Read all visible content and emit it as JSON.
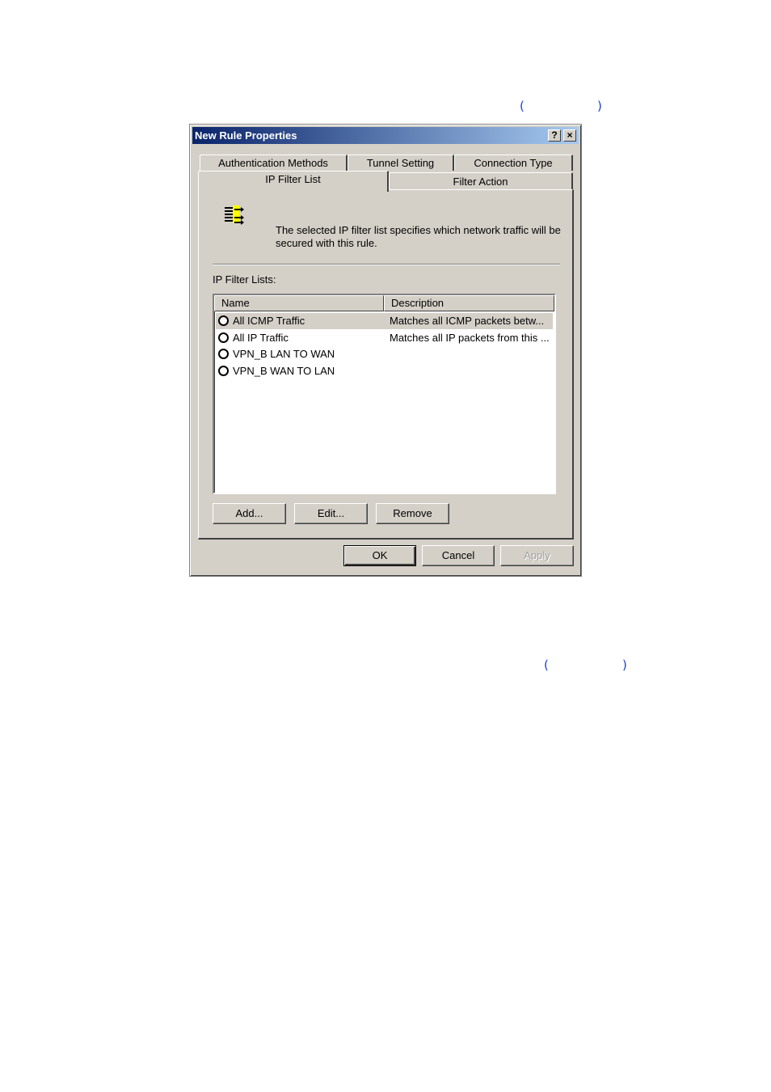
{
  "paren_top": {
    "open": "(",
    "close": ")"
  },
  "paren_bottom": {
    "open": "(",
    "close": ")"
  },
  "dialog": {
    "title": "New Rule Properties",
    "help_glyph": "?",
    "close_glyph": "×"
  },
  "tabs": {
    "row_back": [
      "Authentication Methods",
      "Tunnel Setting",
      "Connection Type"
    ],
    "row_front": [
      "IP Filter List",
      "Filter Action"
    ],
    "active": "IP Filter List"
  },
  "panel": {
    "description": "The selected IP filter list specifies which network traffic will be secured with this rule.",
    "list_label": "IP Filter Lists:",
    "columns": [
      "Name",
      "Description"
    ],
    "rows": [
      {
        "name": "All ICMP Traffic",
        "description": "Matches all ICMP packets betw...",
        "selected": true
      },
      {
        "name": "All IP Traffic",
        "description": "Matches all IP packets from this ...",
        "selected": false
      },
      {
        "name": "VPN_B LAN TO WAN",
        "description": "",
        "selected": false
      },
      {
        "name": "VPN_B WAN TO LAN",
        "description": "",
        "selected": false
      }
    ],
    "buttons": {
      "add": "Add...",
      "edit": "Edit...",
      "remove": "Remove"
    }
  },
  "footer_buttons": {
    "ok": "OK",
    "cancel": "Cancel",
    "apply": "Apply"
  },
  "colors": {
    "title_start": "#0a246a",
    "title_end": "#a6caf0",
    "face": "#d4d0c8",
    "paren": "#1f3fd0"
  }
}
